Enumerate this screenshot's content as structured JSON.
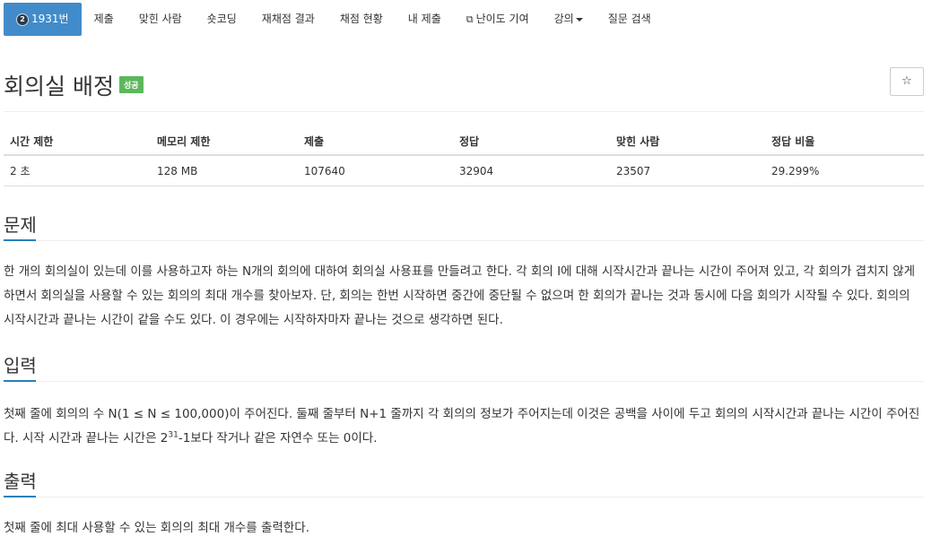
{
  "tabs": {
    "problem_number": "1931번",
    "submit": "제출",
    "solved_users": "맞힌 사람",
    "short_coding": "숏코딩",
    "rejudge": "재채점 결과",
    "judge_status": "채점 현황",
    "my_submissions": "내 제출",
    "difficulty": "난이도 기여",
    "lectures": "강의",
    "question_search": "질문 검색"
  },
  "problem": {
    "title": "회의실 배정",
    "status_badge": "성공",
    "star_icon": "☆",
    "tier_icon_text": "2"
  },
  "stats": {
    "headers": [
      "시간 제한",
      "메모리 제한",
      "제출",
      "정답",
      "맞힌 사람",
      "정답 비율"
    ],
    "values": [
      "2 초",
      "128 MB",
      "107640",
      "32904",
      "23507",
      "29.299%"
    ]
  },
  "sections": {
    "description_title": "문제",
    "description": "한 개의 회의실이 있는데 이를 사용하고자 하는 N개의 회의에 대하여 회의실 사용표를 만들려고 한다. 각 회의 I에 대해 시작시간과 끝나는 시간이 주어져 있고, 각 회의가 겹치지 않게 하면서 회의실을 사용할 수 있는 회의의 최대 개수를 찾아보자. 단, 회의는 한번 시작하면 중간에 중단될 수 없으며 한 회의가 끝나는 것과 동시에 다음 회의가 시작될 수 있다. 회의의 시작시간과 끝나는 시간이 같을 수도 있다. 이 경우에는 시작하자마자 끝나는 것으로 생각하면 된다.",
    "input_title": "입력",
    "input_part1": "첫째 줄에 회의의 수 N(1 ≤ N ≤ 100,000)이 주어진다. 둘째 줄부터 N+1 줄까지 각 회의의 정보가 주어지는데 이것은 공백을 사이에 두고 회의의 시작시간과 끝나는 시간이 주어진다. 시작 시간과 끝나는 시간은 2",
    "input_sup": "31",
    "input_part2": "-1보다 작거나 같은 자연수 또는 0이다.",
    "output_title": "출력",
    "output": "첫째 줄에 최대 사용할 수 있는 회의의 최대 개수를 출력한다."
  },
  "colors": {
    "active_tab": "#428bca",
    "success_badge": "#5cb85c",
    "section_underline": "#2980b9"
  }
}
